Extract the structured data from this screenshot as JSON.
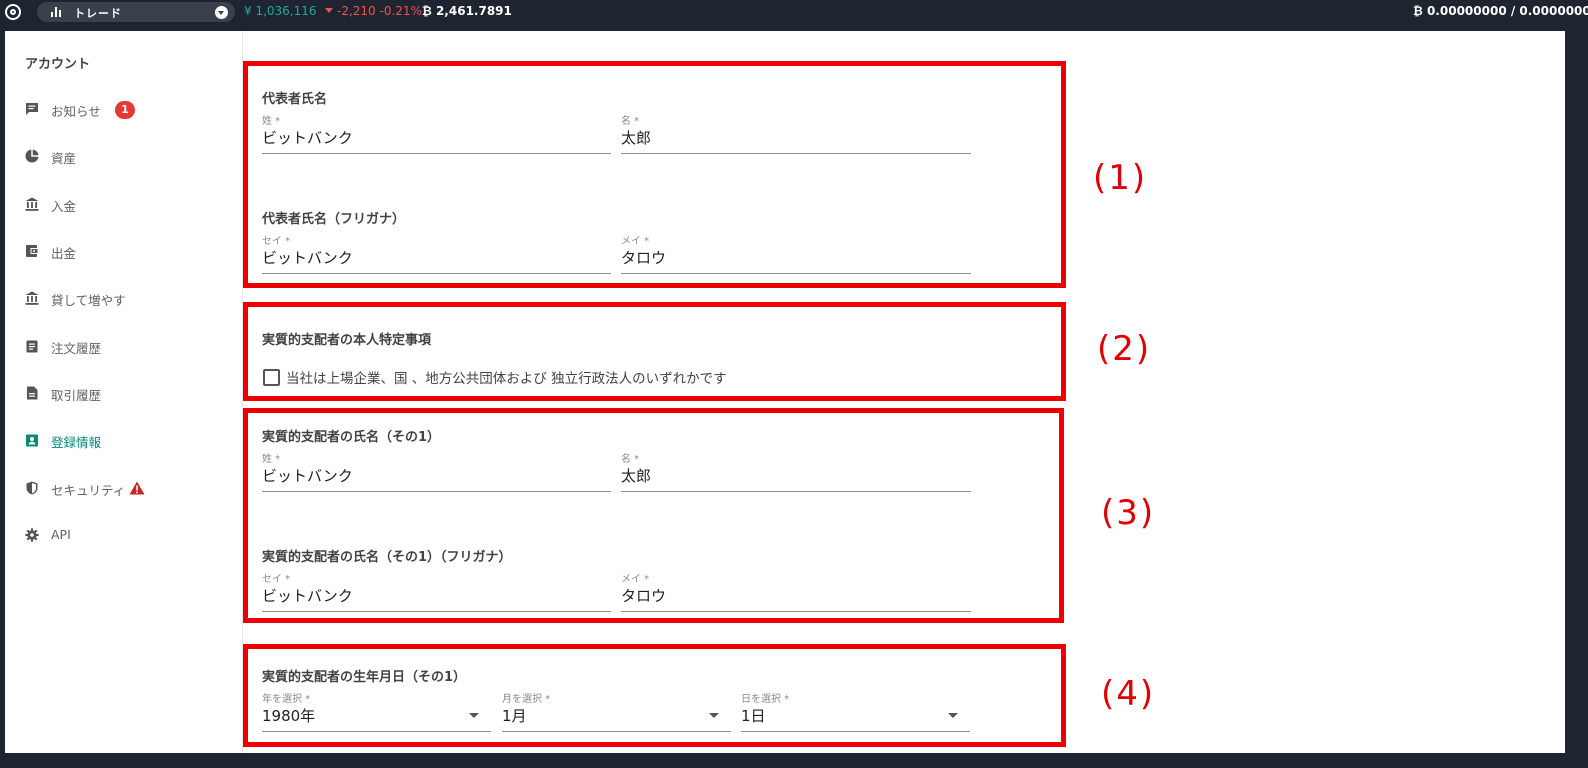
{
  "topbar": {
    "trade_label": "トレード",
    "jpy_value": "¥ 1,036,116",
    "change": "-2,210 -0.21%",
    "btc_price": "₿ 2,461.7891",
    "balance": "₿ 0.00000000 / 0.0000000"
  },
  "sidebar": {
    "title": "アカウント",
    "items": [
      {
        "label": "お知らせ",
        "icon": "message-icon",
        "badge": "1"
      },
      {
        "label": "資産",
        "icon": "pie-chart-icon"
      },
      {
        "label": "入金",
        "icon": "bank-icon"
      },
      {
        "label": "出金",
        "icon": "wallet-icon"
      },
      {
        "label": "貸して増やす",
        "icon": "bank-icon"
      },
      {
        "label": "注文履歴",
        "icon": "clipboard-icon"
      },
      {
        "label": "取引履歴",
        "icon": "document-icon"
      },
      {
        "label": "登録情報",
        "icon": "contact-icon",
        "active": true
      },
      {
        "label": "セキュリティ",
        "icon": "shield-icon",
        "warning": true
      },
      {
        "label": "API",
        "icon": "gear-icon"
      }
    ]
  },
  "sections": {
    "s1": {
      "title": "代表者氏名",
      "last_label": "姓 *",
      "last_value": "ビットバンク",
      "first_label": "名 *",
      "first_value": "太郎",
      "kana_title": "代表者氏名（フリガナ）",
      "kana_last_label": "セイ *",
      "kana_last_value": "ビットバンク",
      "kana_first_label": "メイ *",
      "kana_first_value": "タロウ",
      "annotation": "(1)"
    },
    "s2": {
      "title": "実質的支配者の本人特定事項",
      "checkbox_label": "当社は上場企業、国 、地方公共団体および 独立行政法人のいずれかです",
      "checked": false,
      "annotation": "(2)"
    },
    "s3": {
      "title": "実質的支配者の氏名（その1）",
      "last_label": "姓 *",
      "last_value": "ビットバンク",
      "first_label": "名 *",
      "first_value": "太郎",
      "kana_title": "実質的支配者の氏名（その1）（フリガナ）",
      "kana_last_label": "セイ *",
      "kana_last_value": "ビットバンク",
      "kana_first_label": "メイ *",
      "kana_first_value": "タロウ",
      "annotation": "(3)"
    },
    "s4": {
      "title": "実質的支配者の生年月日（その1）",
      "year_label": "年を選択 *",
      "year_value": "1980年",
      "month_label": "月を選択 *",
      "month_value": "1月",
      "day_label": "日を選択 *",
      "day_value": "1日",
      "annotation": "(4)"
    }
  },
  "colors": {
    "accent": "#00897b",
    "highlight": "#ee0000",
    "topbar": "#1e2530"
  }
}
